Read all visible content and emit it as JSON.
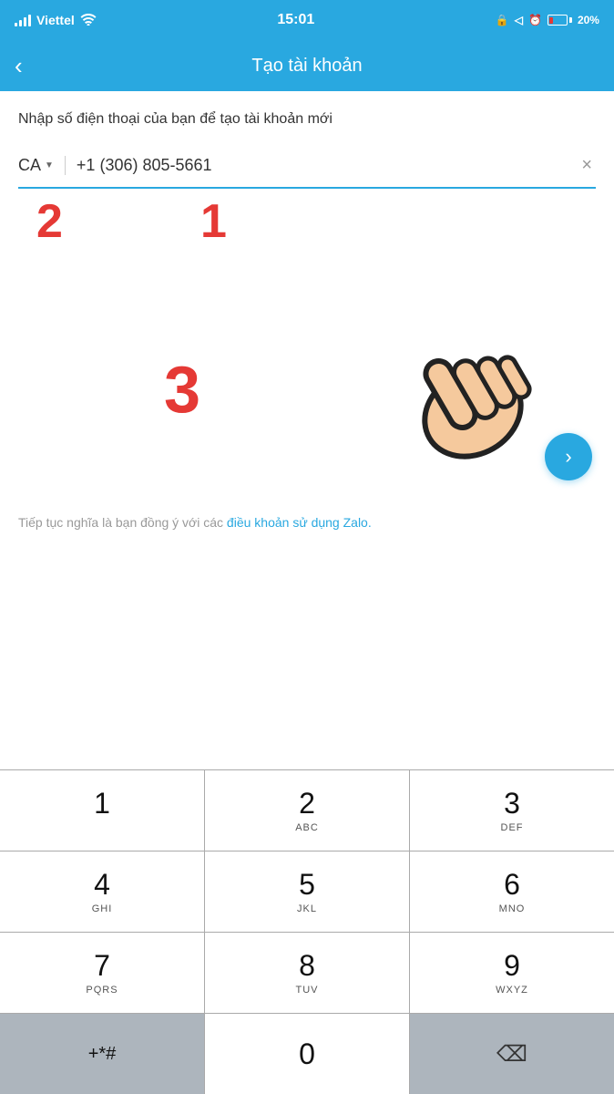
{
  "statusBar": {
    "carrier": "Viettel",
    "time": "15:01",
    "battery_percent": "20%"
  },
  "header": {
    "back_label": "‹",
    "title": "Tạo tài khoản"
  },
  "form": {
    "subtitle": "Nhập số điện thoại của bạn để tạo tài khoản mới",
    "country_code": "CA",
    "phone_prefix": "+1 (306) 805-5661",
    "clear_icon": "×"
  },
  "annotations": {
    "num1": "1",
    "num2": "2",
    "num3": "3"
  },
  "terms": {
    "text": "Tiếp tục nghĩa là bạn đồng ý với các ",
    "link": "điều khoản sử dụng Zalo.",
    "after": ""
  },
  "keyboard": {
    "rows": [
      [
        {
          "num": "1",
          "letters": ""
        },
        {
          "num": "2",
          "letters": "ABC"
        },
        {
          "num": "3",
          "letters": "DEF"
        }
      ],
      [
        {
          "num": "4",
          "letters": "GHI"
        },
        {
          "num": "5",
          "letters": "JKL"
        },
        {
          "num": "6",
          "letters": "MNO"
        }
      ],
      [
        {
          "num": "7",
          "letters": "PQRS"
        },
        {
          "num": "8",
          "letters": "TUV"
        },
        {
          "num": "9",
          "letters": "WXYZ"
        }
      ],
      [
        {
          "num": "+*#",
          "letters": "",
          "special": true
        },
        {
          "num": "0",
          "letters": ""
        },
        {
          "num": "⌫",
          "letters": "",
          "special": true
        }
      ]
    ]
  }
}
